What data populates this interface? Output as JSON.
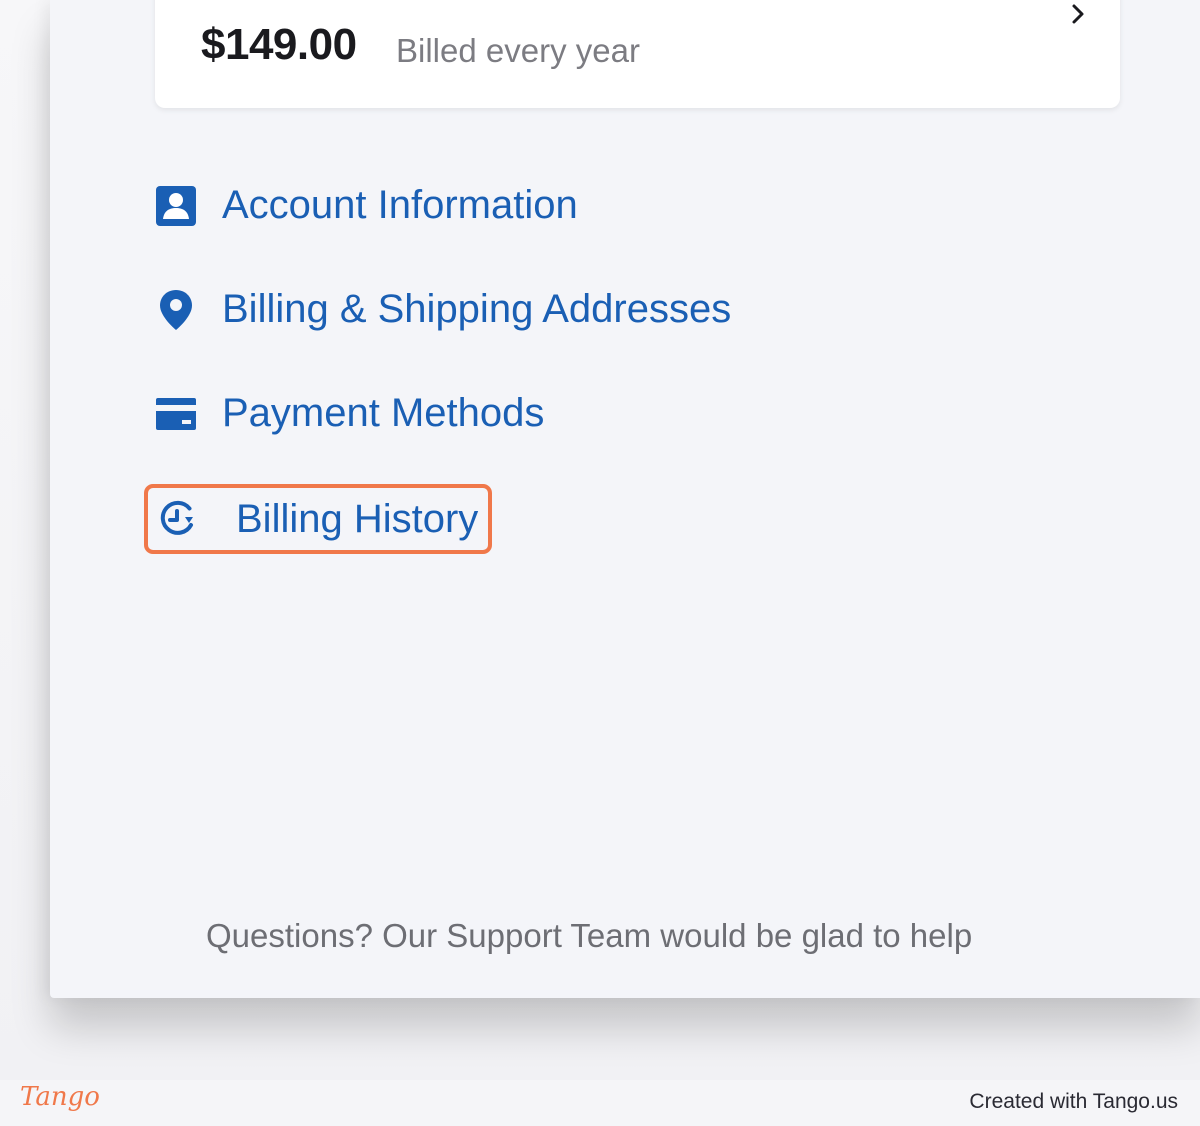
{
  "plan": {
    "price": "$149.00",
    "period": "Billed every year",
    "chevron_icon": "chevron-right-icon"
  },
  "menu": {
    "items": [
      {
        "label": "Account Information",
        "icon": "account-badge-icon"
      },
      {
        "label": "Billing & Shipping Addresses",
        "icon": "map-pin-icon"
      },
      {
        "label": "Payment Methods",
        "icon": "credit-card-icon"
      },
      {
        "label": "Billing History",
        "icon": "history-icon",
        "highlighted": true
      }
    ]
  },
  "support": {
    "text": "Questions? Our Support Team would be glad to help"
  },
  "footer": {
    "logo": "Tango",
    "created_with": "Created with Tango.us"
  },
  "colors": {
    "link": "#1a5fb4",
    "highlight": "#f0784a",
    "panel_bg": "#f4f5f9"
  }
}
